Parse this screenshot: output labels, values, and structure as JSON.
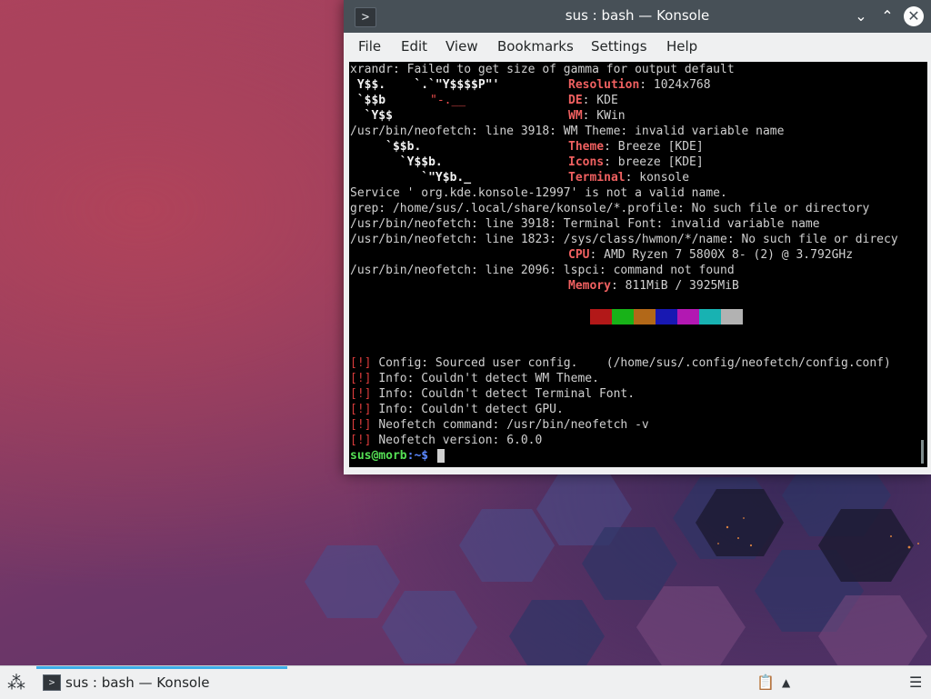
{
  "window": {
    "title": "sus : bash — Konsole",
    "app_icon": "terminal-icon",
    "controls": [
      "minimize",
      "maximize",
      "close"
    ]
  },
  "menubar": {
    "items": [
      "File",
      "Edit",
      "View",
      "Bookmarks",
      "Settings",
      "Help"
    ]
  },
  "terminal": {
    "line_xrandr": "xrandr: Failed to get size of gamma for output default",
    "art": [
      " Y$$.    `.`\"Y$$$$P\"'",
      " `$$b",
      "  `Y$$",
      "     `$$b.",
      "       `Y$$b.",
      "          `\"Y$b._"
    ],
    "art_red_1": "\"-.__",
    "resolution_key": "Resolution",
    "resolution_val": ": 1024x768",
    "de_key": "DE",
    "de_val": ": KDE",
    "wm_key": "WM",
    "wm_val": ": KWin",
    "err_wm_theme": "/usr/bin/neofetch: line 3918: WM Theme: invalid variable name",
    "theme_key": "Theme",
    "theme_val": ": Breeze [KDE]",
    "icons_key": "Icons",
    "icons_val": ": breeze [KDE]",
    "terminal_key": "Terminal",
    "terminal_val": ": konsole",
    "err_service": "Service ' org.kde.konsole-12997' is not a valid name.",
    "err_grep": "grep: /home/sus/.local/share/konsole/*.profile: No such file or directory",
    "err_term_font": "/usr/bin/neofetch: line 3918: Terminal Font: invalid variable name",
    "err_hwmon": "/usr/bin/neofetch: line 1823: /sys/class/hwmon/*/name: No such file or direcy",
    "cpu_key": "CPU",
    "cpu_val": ": AMD Ryzen 7 5800X 8- (2) @ 3.792GHz",
    "err_lspci": "/usr/bin/neofetch: line 2096: lspci: command not found",
    "memory_key": "Memory",
    "memory_val": ": 811MiB / 3925MiB",
    "palette": [
      "#b21818",
      "#18b218",
      "#b26818",
      "#1818b2",
      "#b218b2",
      "#18b2b2",
      "#b2b2b2"
    ],
    "bang": "[!]",
    "info_lines": [
      "Config: Sourced user config.    (/home/sus/.config/neofetch/config.conf)",
      "Info: Couldn't detect WM Theme.",
      "Info: Couldn't detect Terminal Font.",
      "Info: Couldn't detect GPU.",
      "Neofetch command: /usr/bin/neofetch -v",
      "Neofetch version: 6.0.0"
    ],
    "prompt_user": "sus@morb",
    "prompt_path": ":~$ "
  },
  "taskbar": {
    "launcher_icon": "application-launcher-icon",
    "task_label": "sus : bash — Konsole",
    "tray_icons": [
      "clipboard-icon",
      "expand-tray-icon",
      "panel-menu-icon"
    ]
  },
  "colors": {
    "titlebar": "#475057",
    "accent": "#3daee9",
    "terminal_bg": "#000000",
    "prompt_green": "#55e055",
    "key_red": "#f06060"
  }
}
